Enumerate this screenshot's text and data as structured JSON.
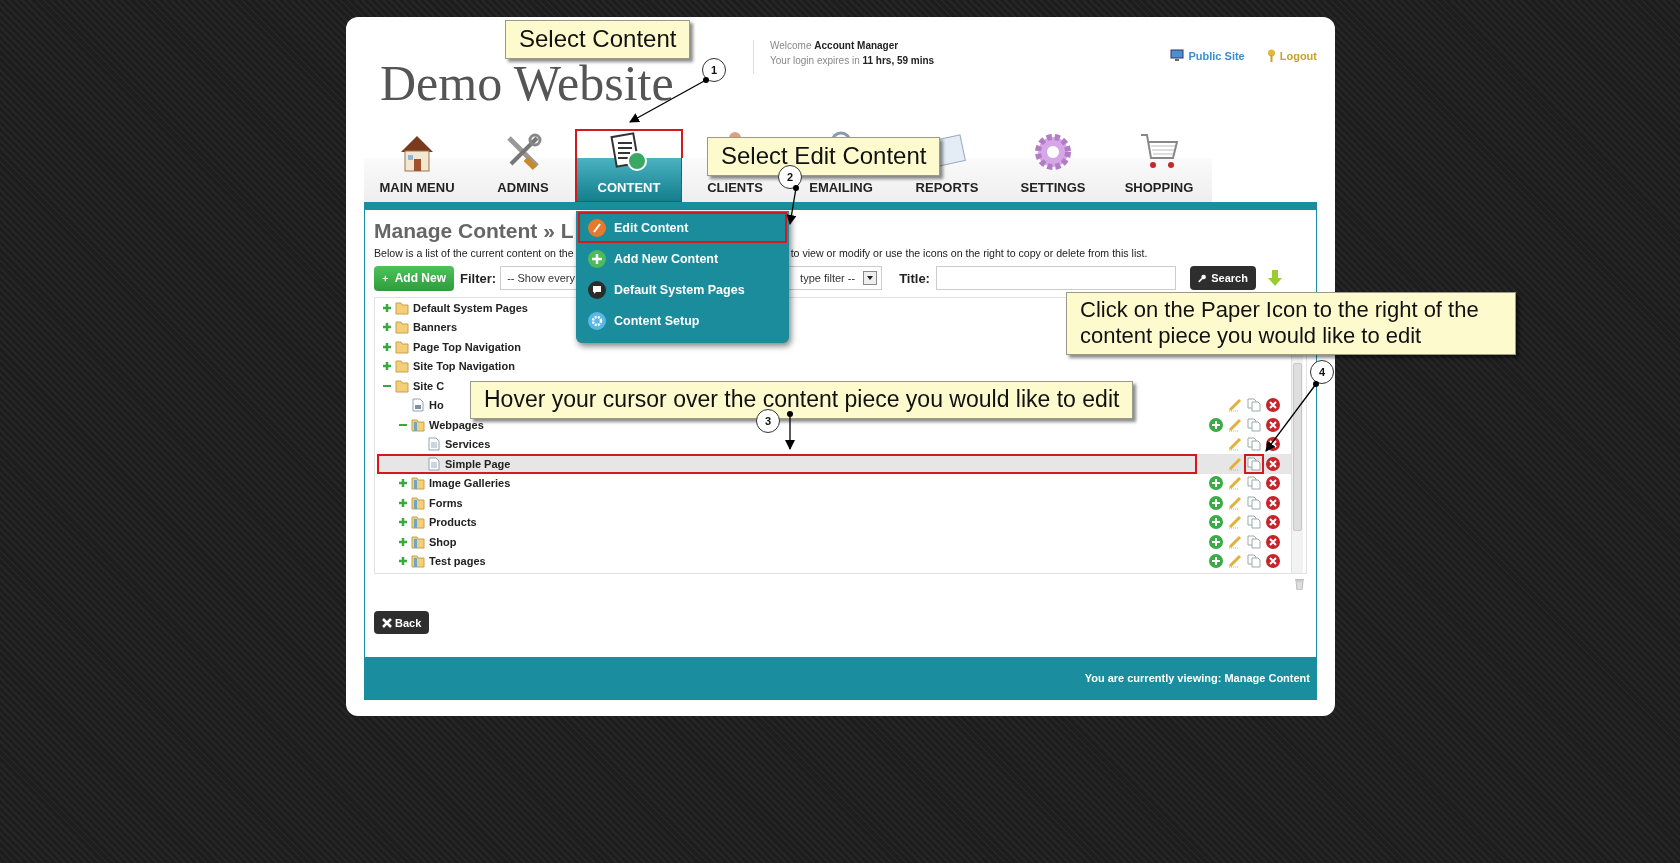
{
  "header": {
    "logo": "Demo Website",
    "welcome_label": "Welcome",
    "user": "Account Manager",
    "expiry_label": "Your login expires in",
    "expiry": "11 hrs, 59 mins",
    "links": [
      {
        "label": "Public Site",
        "kind": "monitor"
      },
      {
        "label": "Logout",
        "kind": "key"
      }
    ]
  },
  "nav_tabs": [
    {
      "label": "MAIN MENU",
      "kind": "home",
      "selected": false,
      "annotated": false
    },
    {
      "label": "ADMINS",
      "kind": "tools",
      "selected": false,
      "annotated": false
    },
    {
      "label": "CONTENT",
      "kind": "content",
      "selected": true,
      "annotated": true
    },
    {
      "label": "CLIENTS",
      "kind": "person",
      "selected": false,
      "annotated": false
    },
    {
      "label": "EMAILING",
      "kind": "email",
      "selected": false,
      "annotated": false
    },
    {
      "label": "REPORTS",
      "kind": "report",
      "selected": false,
      "annotated": false
    },
    {
      "label": "SETTINGS",
      "kind": "gear",
      "selected": false,
      "annotated": false
    },
    {
      "label": "SHOPPING",
      "kind": "cart",
      "selected": false,
      "annotated": false
    }
  ],
  "content_menu": [
    {
      "label": "Edit Content",
      "kind": "edit",
      "annotated": true
    },
    {
      "label": "Add New Content",
      "kind": "add",
      "annotated": false
    },
    {
      "label": "Default System Pages",
      "kind": "pages",
      "annotated": false
    },
    {
      "label": "Content Setup",
      "kind": "setup",
      "annotated": false
    }
  ],
  "page": {
    "title": "Manage Content » L",
    "description": [
      "Below is a list of the current content on the",
      "to view or modify or use the icons on the right to copy or delete from this list."
    ],
    "add_button": "Add New",
    "filter_label": "Filter:",
    "filter_value": "-- Show every",
    "type_value": "type filter --",
    "title_label": "Title:",
    "search_button": "Search"
  },
  "tree": {
    "items": [
      {
        "name": "Default System Pages",
        "kind": "folder",
        "expanded": false,
        "selected": false,
        "annotated": false
      },
      {
        "name": "Banners",
        "kind": "folder",
        "expanded": false,
        "selected": false,
        "annotated": false
      },
      {
        "name": "Page Top Navigation",
        "kind": "folder",
        "expanded": false,
        "selected": false,
        "annotated": false
      },
      {
        "name": "Site Top Navigation",
        "kind": "folder",
        "expanded": false,
        "selected": false,
        "annotated": false,
        "actions": false
      },
      {
        "name": "Site C",
        "kind": "folder",
        "expanded": true,
        "selected": false,
        "annotated": false,
        "actions": false,
        "children": [
          {
            "name": "Ho",
            "kind": "home-page",
            "selected": false,
            "annotated": false,
            "actions": true,
            "can_add": false
          },
          {
            "name": "Webpages",
            "kind": "section",
            "expanded": true,
            "selected": false,
            "annotated": false,
            "actions": true,
            "can_add": true,
            "children": [
              {
                "name": "Services",
                "kind": "page",
                "selected": false,
                "annotated": false,
                "actions": true,
                "can_add": false
              },
              {
                "name": "Simple Page",
                "kind": "page",
                "selected": true,
                "annotated": true,
                "actions": true,
                "can_add": false,
                "copy_annotated": true
              }
            ]
          },
          {
            "name": "Image Galleries",
            "kind": "section",
            "expanded": false,
            "selected": false,
            "annotated": false,
            "actions": true,
            "can_add": true
          },
          {
            "name": "Forms",
            "kind": "section",
            "expanded": false,
            "selected": false,
            "annotated": false,
            "actions": true,
            "can_add": true
          },
          {
            "name": "Products",
            "kind": "section",
            "expanded": false,
            "selected": false,
            "annotated": false,
            "actions": true,
            "can_add": true
          },
          {
            "name": "Shop",
            "kind": "section",
            "expanded": false,
            "selected": false,
            "annotated": false,
            "actions": true,
            "can_add": true
          },
          {
            "name": "Test pages",
            "kind": "section",
            "expanded": false,
            "selected": false,
            "annotated": false,
            "actions": true,
            "can_add": true
          }
        ]
      }
    ]
  },
  "back_button": "Back",
  "footer": "You are currently viewing: Manage Content",
  "callouts": [
    {
      "number": "1",
      "text": "Select Content"
    },
    {
      "number": "2",
      "text": "Select Edit Content"
    },
    {
      "number": "3",
      "text": "Hover your cursor over the content piece you would like to edit"
    },
    {
      "number": "4",
      "text": "Click on the Paper Icon to the right of the content piece you would like to edit"
    }
  ]
}
